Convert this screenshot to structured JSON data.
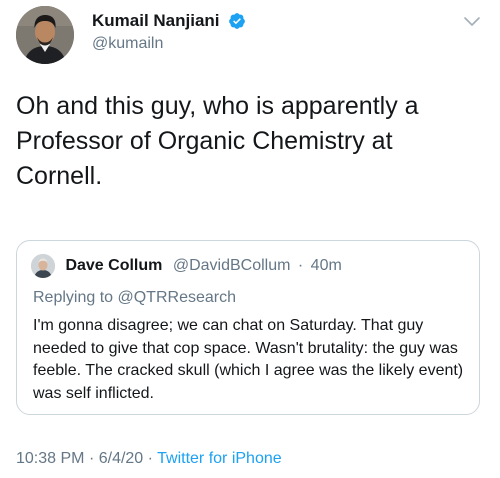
{
  "author": {
    "display_name": "Kumail Nanjiani",
    "handle": "@kumailn",
    "verified": true,
    "verified_icon": "verified-badge-icon",
    "verified_color": "#1da1f2"
  },
  "menu_icon": "chevron-down-icon",
  "tweet_text": "Oh and this guy, who is apparently a Professor of Organic Chemistry at Cornell.",
  "quoted_tweet": {
    "display_name": "Dave Collum",
    "handle": "@DavidBCollum",
    "separator": "·",
    "time": "40m",
    "replying_to": "Replying to @QTRResearch",
    "text": "I'm gonna disagree; we can chat on Saturday. That guy needed to give that cop space. Wasn't brutality: the guy was feeble. The cracked skull (which I agree was the likely event) was self inflicted."
  },
  "meta": {
    "time": "10:38 PM",
    "date": "6/4/20",
    "separator": "·",
    "source": "Twitter for iPhone"
  },
  "colors": {
    "text": "#14171a",
    "secondary": "#657786",
    "accent": "#1da1f2",
    "border": "#ccd6dd"
  }
}
